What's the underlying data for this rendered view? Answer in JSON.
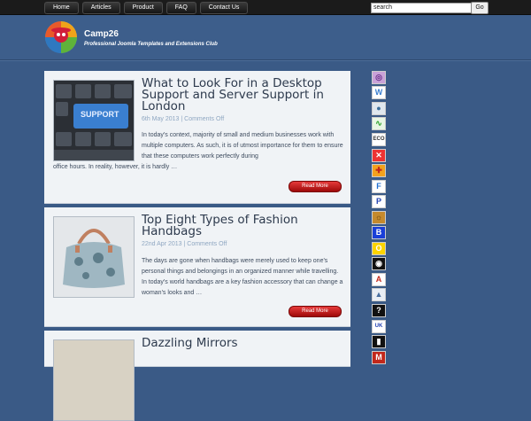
{
  "nav": {
    "items": [
      "Home",
      "Articles",
      "Product",
      "FAQ",
      "Contact Us"
    ]
  },
  "search": {
    "value": "search",
    "button": "Go"
  },
  "site": {
    "title": "Camp26",
    "tagline": "Professional Joomla Templates and Extensions Club"
  },
  "posts": [
    {
      "title": "What to Look For in a Desktop Support and Server Support in London",
      "date": "6th May 2013",
      "comments": "Comments Off",
      "excerpt_narrow": "In today's context, majority of small and medium businesses work with multiple computers. As such, it is of utmost importance for them to ensure that these computers work perfectly during",
      "excerpt_wide": "office hours. In reality, however, it is hardly …",
      "read_more": "Read More",
      "thumb_text": "SUPPORT"
    },
    {
      "title": "Top Eight Types of Fashion Handbags",
      "date": "22nd Apr 2013",
      "comments": "Comments Off",
      "excerpt_narrow": "The days are gone when handbags were merely used to keep one's personal things and belongings in an organized manner while travelling. In today's world handbags are a key fashion accessory that can change a woman's looks and …",
      "read_more": "Read More"
    },
    {
      "title": "Dazzling Mirrors"
    }
  ],
  "sidebar_icons": [
    "globe-icon",
    "w-icon",
    "circle-icon",
    "chart-icon",
    "eco-icon",
    "x-icon",
    "puzzle-icon",
    "f-icon",
    "p-icon",
    "lion-icon",
    "b-icon",
    "o-icon",
    "camera-icon",
    "a-icon",
    "mountain-icon",
    "q-icon",
    "uk-icon",
    "boots-icon",
    "m-icon"
  ],
  "colors": {
    "background": "#3a5a86",
    "post_bg": "#f0f3f6",
    "title": "#2d3a4d",
    "meta": "#8fa7c2",
    "read_more": "#c81e1e"
  }
}
